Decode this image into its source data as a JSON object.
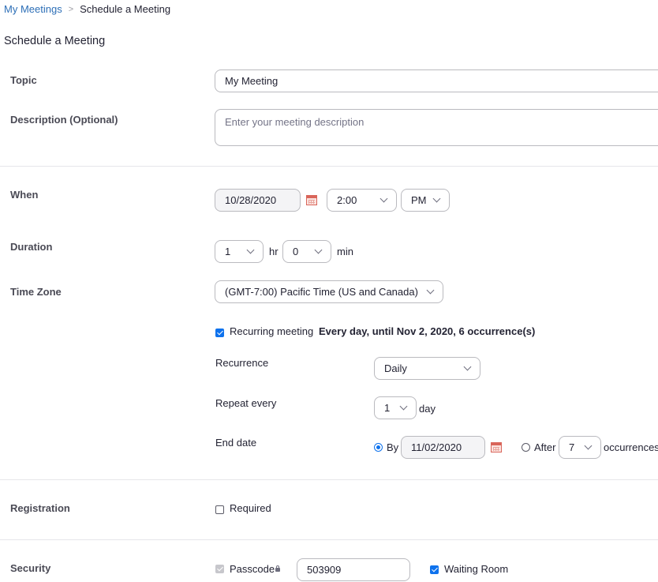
{
  "breadcrumb": {
    "parent": "My Meetings",
    "separator": ">",
    "current": "Schedule a Meeting"
  },
  "page_title": "Schedule a Meeting",
  "topic": {
    "label": "Topic",
    "value": "My Meeting"
  },
  "description": {
    "label": "Description (Optional)",
    "placeholder": "Enter your meeting description"
  },
  "when": {
    "label": "When",
    "date": "10/28/2020",
    "time": "2:00",
    "ampm": "PM",
    "calendar_icon": "calendar-icon"
  },
  "duration": {
    "label": "Duration",
    "hours": "1",
    "hr_label": "hr",
    "minutes": "0",
    "min_label": "min"
  },
  "timezone": {
    "label": "Time Zone",
    "value": "(GMT-7:00) Pacific Time (US and Canada)"
  },
  "recurring": {
    "checkbox_label": "Recurring meeting",
    "checked": true,
    "summary": "Every day, until Nov 2, 2020, 6 occurrence(s)",
    "recurrence_label": "Recurrence",
    "recurrence_value": "Daily",
    "repeat_label": "Repeat every",
    "repeat_value": "1",
    "repeat_unit": "day",
    "end_label": "End date",
    "by_label": "By",
    "by_date": "11/02/2020",
    "after_label": "After",
    "after_value": "7",
    "occurrences_label": "occurrences"
  },
  "registration": {
    "label": "Registration",
    "required_label": "Required",
    "checked": false
  },
  "security": {
    "label": "Security",
    "passcode_label": "Passcode",
    "passcode_value": "503909",
    "waiting_room_label": "Waiting Room",
    "waiting_room_checked": true
  },
  "colors": {
    "accent": "#0e72ed",
    "link": "#2d6fb7",
    "text": "#232333",
    "border": "#bababf"
  }
}
